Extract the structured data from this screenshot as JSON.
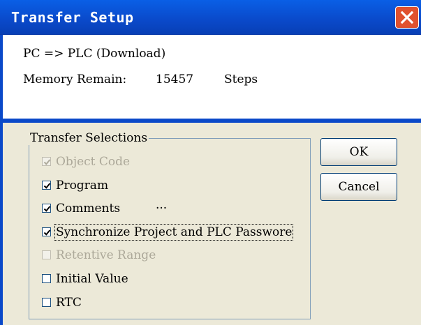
{
  "window": {
    "title": "Transfer Setup"
  },
  "info": {
    "direction": "PC => PLC (Download)",
    "memory_label": "Memory Remain:",
    "memory_value": "15457",
    "memory_unit": "Steps"
  },
  "group": {
    "legend": "Transfer Selections",
    "items": [
      {
        "label": "Object Code",
        "checked": true,
        "enabled": false
      },
      {
        "label": "Program",
        "checked": true,
        "enabled": true
      },
      {
        "label": "Comments",
        "checked": true,
        "enabled": true,
        "extra": "···"
      },
      {
        "label": "Synchronize Project and PLC Passwore",
        "checked": true,
        "enabled": true,
        "focused": true
      },
      {
        "label": "Retentive Range",
        "checked": false,
        "enabled": false
      },
      {
        "label": "Initial Value",
        "checked": false,
        "enabled": true
      },
      {
        "label": "RTC",
        "checked": false,
        "enabled": true
      }
    ]
  },
  "buttons": {
    "ok": "OK",
    "cancel": "Cancel"
  },
  "colors": {
    "titlebar": "#0a49c9",
    "close_button": "#e0512e",
    "dialog_face": "#ece9d8",
    "disabled_text": "#aca899"
  },
  "icons": {
    "close": "close-icon",
    "check": "checkmark-icon"
  }
}
